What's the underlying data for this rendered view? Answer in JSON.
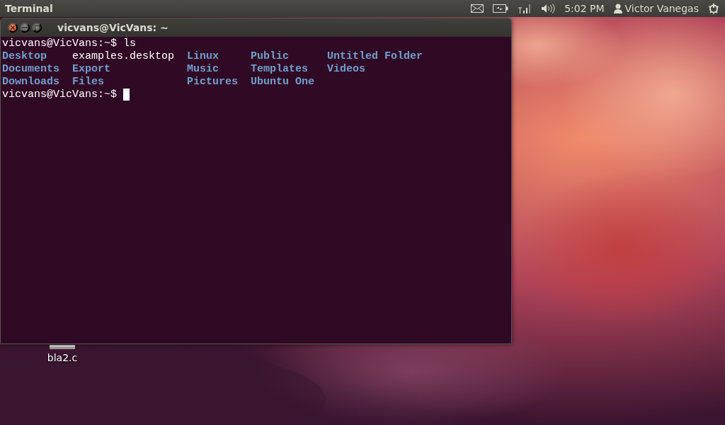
{
  "top_panel": {
    "app_name": "Terminal",
    "clock": "5:02 PM",
    "user": "Victor Vanegas"
  },
  "desktop_icons": [
    {
      "label": "bla2.c"
    }
  ],
  "terminal": {
    "title": "vicvans@VicVans: ~",
    "first_prompt": {
      "prompt": "vicvans@VicVans:~$",
      "command": "ls"
    },
    "listing": [
      [
        {
          "name": "Desktop",
          "kind": "dir"
        },
        {
          "name": "examples.desktop",
          "kind": "file"
        },
        {
          "name": "Linux",
          "kind": "dir"
        },
        {
          "name": "Public",
          "kind": "dir"
        },
        {
          "name": "Untitled Folder",
          "kind": "dir"
        }
      ],
      [
        {
          "name": "Documents",
          "kind": "dir"
        },
        {
          "name": "Export",
          "kind": "dir"
        },
        {
          "name": "Music",
          "kind": "dir"
        },
        {
          "name": "Templates",
          "kind": "dir"
        },
        {
          "name": "Videos",
          "kind": "dir"
        }
      ],
      [
        {
          "name": "Downloads",
          "kind": "dir"
        },
        {
          "name": "Files",
          "kind": "dir"
        },
        {
          "name": "Pictures",
          "kind": "dir"
        },
        {
          "name": "Ubuntu One",
          "kind": "dir"
        }
      ]
    ],
    "last_prompt": {
      "prompt": "vicvans@VicVans:~$"
    }
  }
}
